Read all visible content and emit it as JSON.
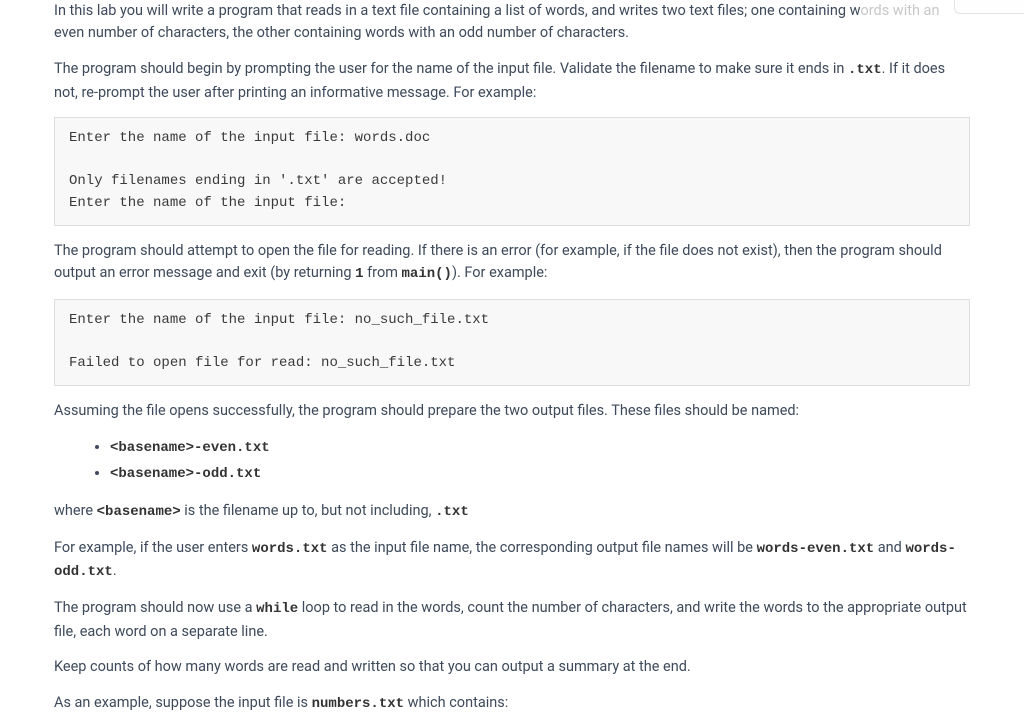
{
  "paragraphs": {
    "p1a": "In this lab you will write a program that reads in a text file containing a list of words, and writes two text files; one containing w",
    "p1b": " even number of characters, the other containing words with an odd number of characters.",
    "p1_truncated": "ords with an",
    "p2a": "The program should begin by prompting the user for the name of the input file. Validate the filename to make sure it ends in ",
    "p2_code": ".txt",
    "p2b": ". If it does not, re-prompt the user after printing an informative message. For example:",
    "code1": "Enter the name of the input file: words.doc\n\nOnly filenames ending in '.txt' are accepted!\nEnter the name of the input file:",
    "p3a": "The program should attempt to open the file for reading. If there is an error (for example, if the file does not exist), then the program should output an error message and exit (by returning ",
    "p3_code1": "1",
    "p3b": " from ",
    "p3_code2": "main()",
    "p3c": "). For example:",
    "code2": "Enter the name of the input file: no_such_file.txt\n\nFailed to open file for read: no_such_file.txt",
    "p4": "Assuming the file opens successfully, the program should prepare the two output files. These files should be named:",
    "list": {
      "item1": "<basename>-even.txt",
      "item2": "<basename>-odd.txt"
    },
    "p5a": "where ",
    "p5_code1": "<basename>",
    "p5b": " is the filename up to, but not including, ",
    "p5_code2": ".txt",
    "p6a": "For example, if the user enters ",
    "p6_code1": "words.txt",
    "p6b": " as the input file name, the corresponding output file names will be ",
    "p6_code2": "words-even.txt",
    "p6c": " and ",
    "p6_code3": "words-odd.txt",
    "p6d": ".",
    "p7a": "The program should now use a ",
    "p7_code": "while",
    "p7b": " loop to read in the words, count the number of characters, and write the words to the appropriate output file, each word on a separate line.",
    "p8": "Keep counts of how many words are read and written so that you can output a summary at the end.",
    "p9a": "As an example, suppose the input file is ",
    "p9_code": "numbers.txt",
    "p9b": " which contains:"
  }
}
